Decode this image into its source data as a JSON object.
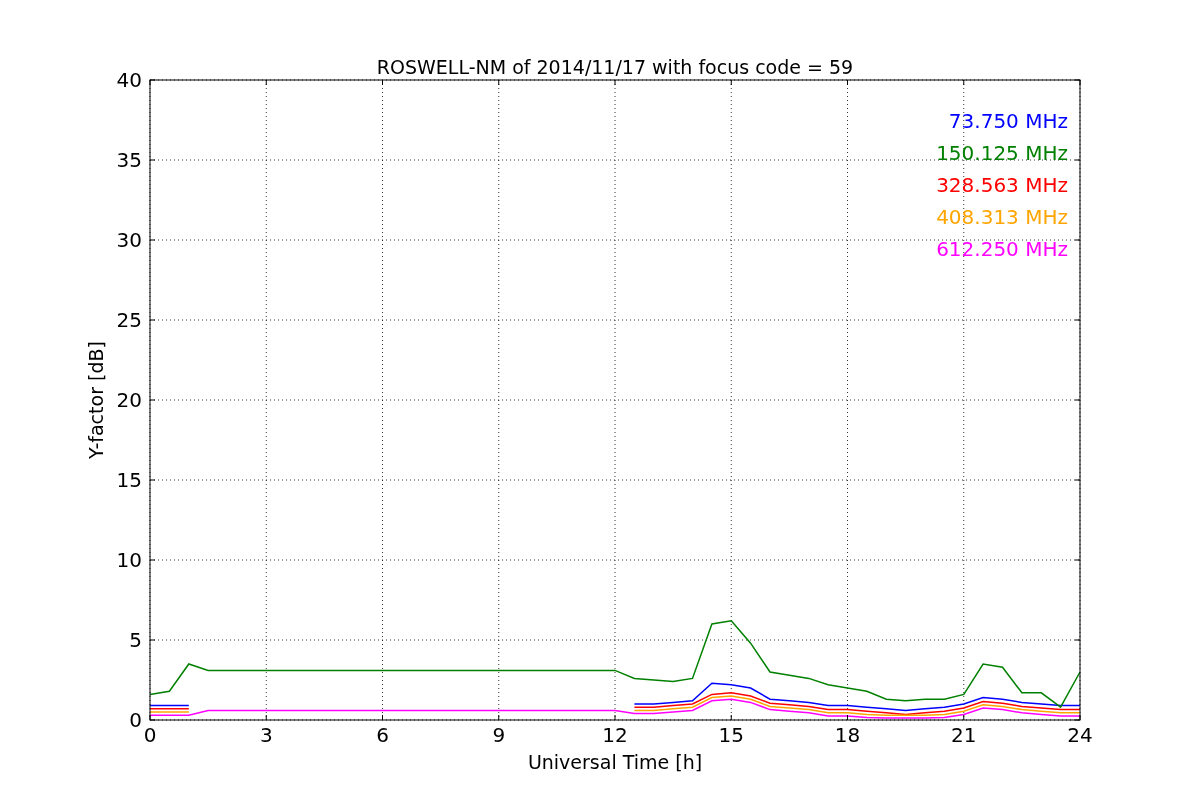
{
  "chart": {
    "chart_data": {
      "type": "line",
      "title": "ROSWELL-NM of 2014/11/17 with focus code = 59",
      "xlabel": "Universal Time [h]",
      "ylabel": "Y-factor [dB]",
      "x": [
        0,
        0.5,
        1,
        1.5,
        2,
        2.5,
        3,
        3.5,
        4,
        4.5,
        5,
        5.5,
        6,
        6.5,
        7,
        7.5,
        8,
        8.5,
        9,
        9.5,
        10,
        10.5,
        11,
        11.5,
        12,
        12.5,
        13,
        13.5,
        14,
        14.5,
        15,
        15.5,
        16,
        16.5,
        17,
        17.5,
        18,
        18.5,
        19,
        19.5,
        20,
        20.5,
        21,
        21.5,
        22,
        22.5,
        23,
        23.5,
        24
      ],
      "series": [
        {
          "name": "73.750 MHz",
          "color": "#0000ff",
          "values": [
            0.9,
            0.9,
            0.9,
            null,
            null,
            null,
            null,
            null,
            null,
            null,
            null,
            null,
            null,
            null,
            null,
            null,
            null,
            null,
            null,
            null,
            null,
            null,
            null,
            null,
            null,
            1.0,
            1.0,
            1.1,
            1.2,
            2.3,
            2.2,
            2.0,
            1.3,
            1.2,
            1.1,
            0.9,
            0.9,
            0.8,
            0.7,
            0.6,
            0.7,
            0.8,
            1.0,
            1.4,
            1.3,
            1.1,
            1.0,
            0.9,
            0.9
          ]
        },
        {
          "name": "150.125 MHz",
          "color": "#008000",
          "values": [
            1.6,
            1.8,
            3.5,
            3.1,
            3.1,
            3.1,
            3.1,
            3.1,
            3.1,
            3.1,
            3.1,
            3.1,
            3.1,
            3.1,
            3.1,
            3.1,
            3.1,
            3.1,
            3.1,
            3.1,
            3.1,
            3.1,
            3.1,
            3.1,
            3.1,
            2.6,
            2.5,
            2.4,
            2.6,
            6.0,
            6.2,
            4.8,
            3.0,
            2.8,
            2.6,
            2.2,
            2.0,
            1.8,
            1.3,
            1.2,
            1.3,
            1.3,
            1.6,
            3.5,
            3.3,
            1.7,
            1.7,
            0.8,
            3.0
          ]
        },
        {
          "name": "328.563 MHz",
          "color": "#ff0000",
          "values": [
            0.7,
            0.7,
            0.7,
            null,
            null,
            null,
            null,
            null,
            null,
            null,
            null,
            null,
            null,
            null,
            null,
            null,
            null,
            null,
            null,
            null,
            null,
            null,
            null,
            null,
            null,
            0.8,
            0.8,
            0.9,
            1.0,
            1.6,
            1.7,
            1.5,
            1.05,
            0.95,
            0.85,
            0.65,
            0.65,
            0.55,
            0.45,
            0.35,
            0.45,
            0.55,
            0.75,
            1.15,
            1.05,
            0.85,
            0.75,
            0.65,
            0.65
          ]
        },
        {
          "name": "408.313 MHz",
          "color": "#ffa500",
          "values": [
            0.5,
            0.5,
            0.5,
            null,
            null,
            null,
            null,
            null,
            null,
            null,
            null,
            null,
            null,
            null,
            null,
            null,
            null,
            null,
            null,
            null,
            null,
            null,
            null,
            null,
            null,
            0.6,
            0.6,
            0.7,
            0.8,
            1.4,
            1.5,
            1.3,
            0.85,
            0.75,
            0.65,
            0.45,
            0.45,
            0.35,
            0.3,
            0.3,
            0.3,
            0.35,
            0.55,
            0.95,
            0.85,
            0.65,
            0.55,
            0.45,
            0.45
          ]
        },
        {
          "name": "612.250 MHz",
          "color": "#ff00ff",
          "values": [
            0.3,
            0.3,
            0.3,
            0.6,
            0.6,
            0.6,
            0.6,
            0.6,
            0.6,
            0.6,
            0.6,
            0.6,
            0.6,
            0.6,
            0.6,
            0.6,
            0.6,
            0.6,
            0.6,
            0.6,
            0.6,
            0.6,
            0.6,
            0.6,
            0.6,
            0.4,
            0.4,
            0.5,
            0.6,
            1.2,
            1.3,
            1.1,
            0.65,
            0.55,
            0.45,
            0.25,
            0.25,
            0.15,
            0.12,
            0.12,
            0.12,
            0.15,
            0.35,
            0.75,
            0.65,
            0.45,
            0.35,
            0.25,
            0.25
          ]
        }
      ],
      "grid": true,
      "xlim": [
        0,
        24
      ],
      "ylim": [
        0,
        40
      ],
      "xticks": [
        0,
        3,
        6,
        9,
        12,
        15,
        18,
        21,
        24
      ],
      "yticks": [
        0,
        5,
        10,
        15,
        20,
        25,
        30,
        35,
        40
      ]
    }
  }
}
